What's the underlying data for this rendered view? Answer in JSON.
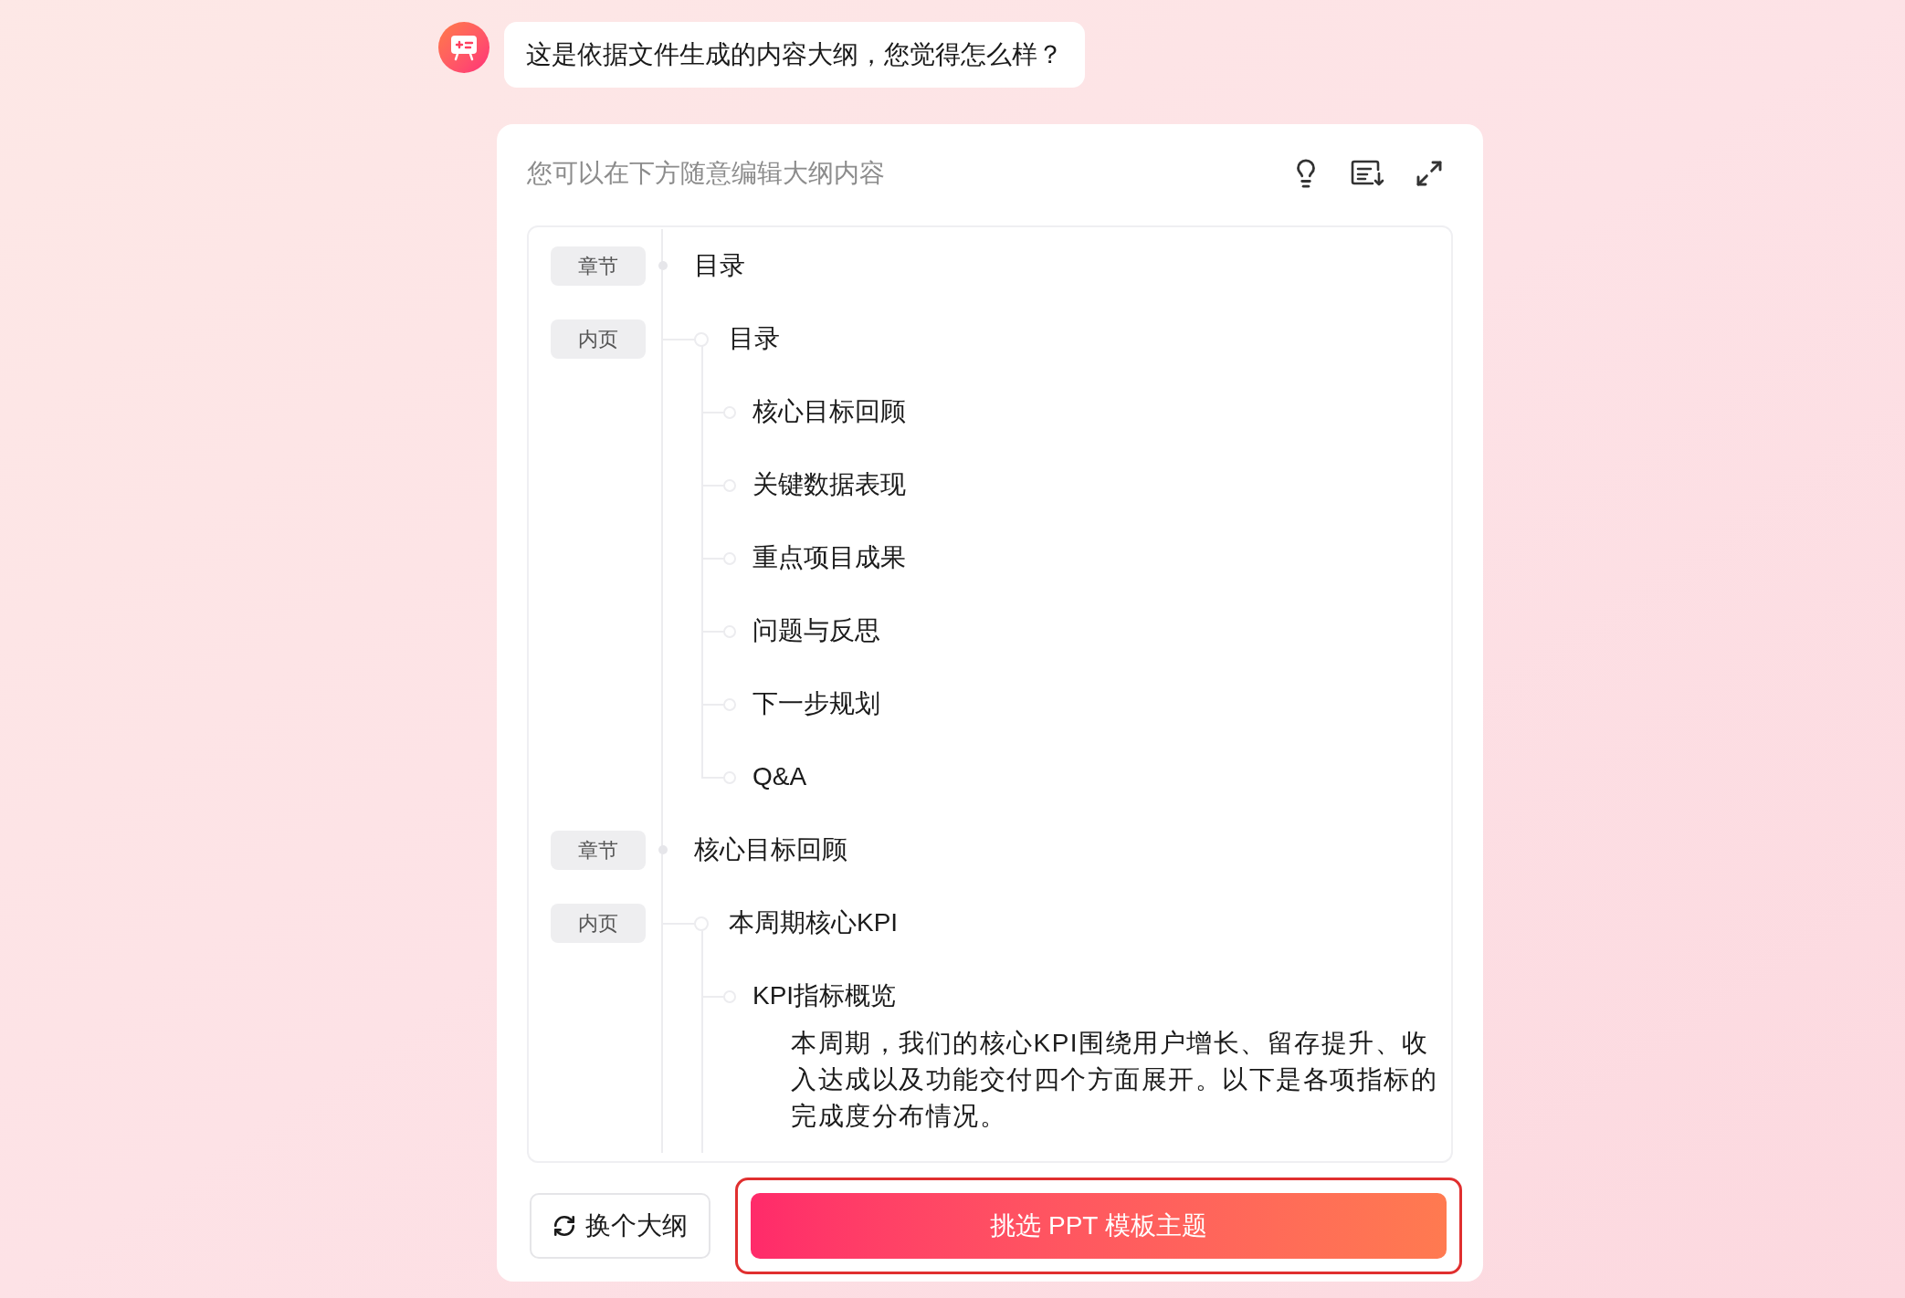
{
  "message": {
    "text": "这是依据文件生成的内容大纲，您觉得怎么样？"
  },
  "outline": {
    "hint": "您可以在下方随意编辑大纲内容",
    "sections": [
      {
        "badge": "章节",
        "title": "目录",
        "pages": [
          {
            "badge": "内页",
            "title": "目录",
            "children": [
              {
                "title": "核心目标回顾"
              },
              {
                "title": "关键数据表现"
              },
              {
                "title": "重点项目成果"
              },
              {
                "title": "问题与反思"
              },
              {
                "title": "下一步规划"
              },
              {
                "title": "Q&A"
              }
            ]
          }
        ]
      },
      {
        "badge": "章节",
        "title": "核心目标回顾",
        "pages": [
          {
            "badge": "内页",
            "title": "本周期核心KPI",
            "children": [
              {
                "title": "KPI指标概览",
                "body": "本周期，我们的核心KPI围绕用户增长、留存提升、收入达成以及功能交付四个方面展开。以下是各项指标的完成度分布情况。"
              }
            ]
          }
        ]
      }
    ]
  },
  "buttons": [
    {
      "kind": "secondary",
      "label": "换个大纲"
    },
    {
      "kind": "primary",
      "label": "挑选 PPT 模板主题",
      "highlighted": true
    }
  ]
}
